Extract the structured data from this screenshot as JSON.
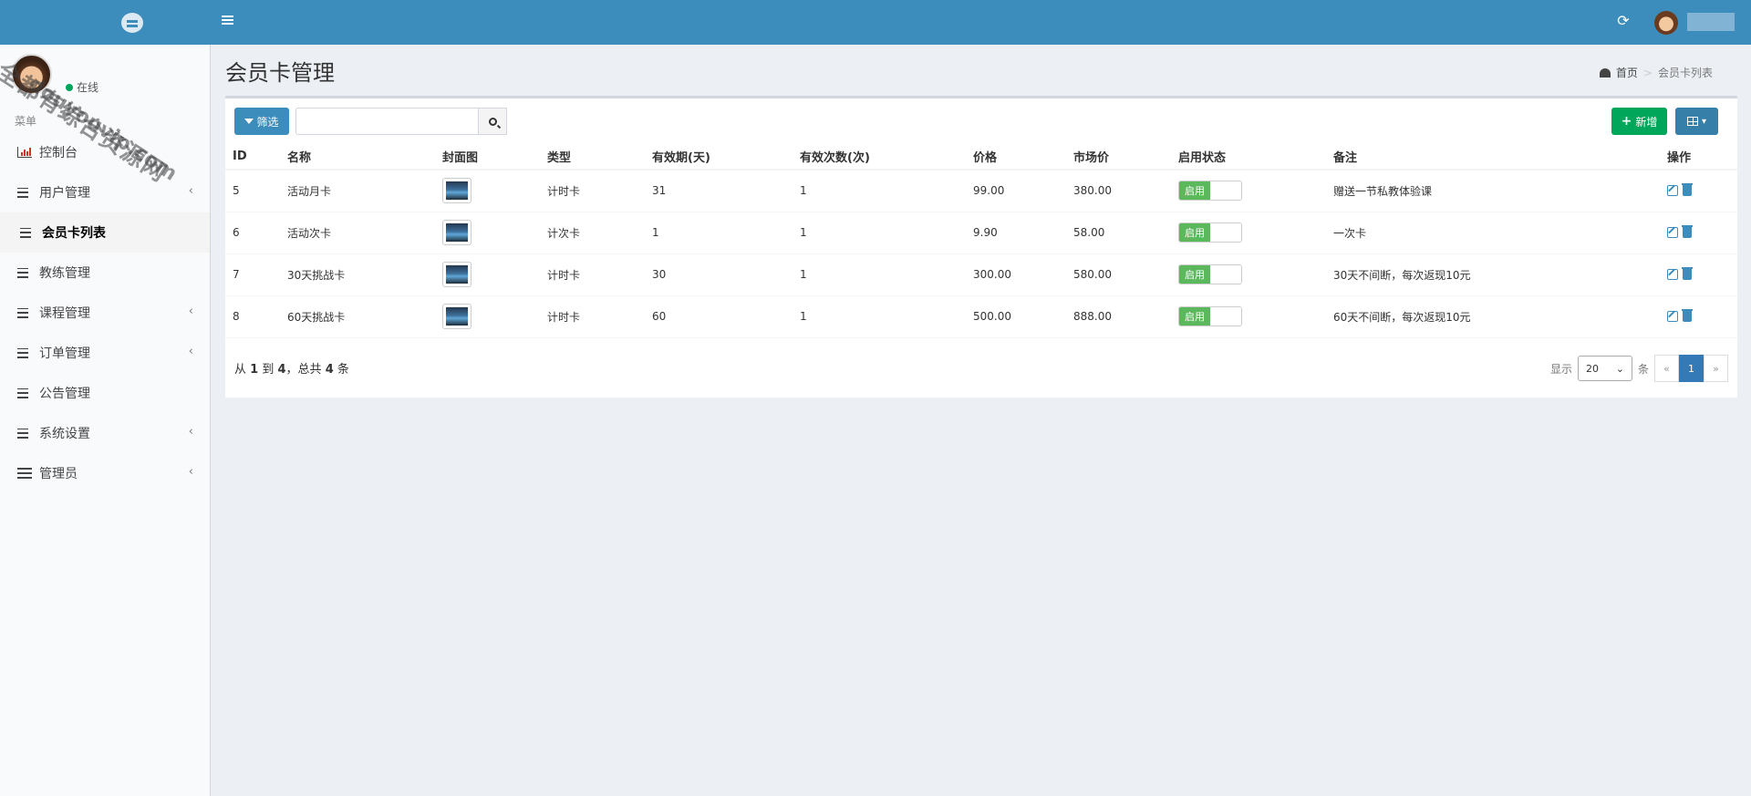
{
  "header": {
    "refresh_icon": "refresh-icon",
    "menu_toggle_icon": "hamburger-icon"
  },
  "sidebar": {
    "status": "在线",
    "menu_header": "菜单",
    "items": [
      {
        "label": "控制台",
        "icon": "bar-chart-icon",
        "has_children": false,
        "active": false
      },
      {
        "label": "用户管理",
        "icon": "list-icon",
        "has_children": true,
        "active": false
      },
      {
        "label": "会员卡列表",
        "icon": "list-icon",
        "has_children": false,
        "active": true
      },
      {
        "label": "教练管理",
        "icon": "list-icon",
        "has_children": false,
        "active": false
      },
      {
        "label": "课程管理",
        "icon": "list-icon",
        "has_children": true,
        "active": false
      },
      {
        "label": "订单管理",
        "icon": "list-icon",
        "has_children": true,
        "active": false
      },
      {
        "label": "公告管理",
        "icon": "list-icon",
        "has_children": false,
        "active": false
      },
      {
        "label": "系统设置",
        "icon": "list-icon",
        "has_children": true,
        "active": false
      },
      {
        "label": "管理员",
        "icon": "table-icon",
        "has_children": true,
        "active": false
      }
    ]
  },
  "watermark": {
    "line1": "全都有综合资源网",
    "line2": "douyouvip.com"
  },
  "page": {
    "title": "会员卡管理",
    "breadcrumb": {
      "home": "首页",
      "current": "会员卡列表"
    }
  },
  "toolbar": {
    "filter_label": "筛选",
    "search_value": "",
    "add_label": "新增"
  },
  "table": {
    "headers": [
      "ID",
      "名称",
      "封面图",
      "类型",
      "有效期(天)",
      "有效次数(次)",
      "价格",
      "市场价",
      "启用状态",
      "备注",
      "操作"
    ],
    "rows": [
      {
        "id": "5",
        "name": "活动月卡",
        "type": "计时卡",
        "days": "31",
        "times": "1",
        "price": "99.00",
        "market": "380.00",
        "status": "启用",
        "note": "赠送一节私教体验课"
      },
      {
        "id": "6",
        "name": "活动次卡",
        "type": "计次卡",
        "days": "1",
        "times": "1",
        "price": "9.90",
        "market": "58.00",
        "status": "启用",
        "note": "一次卡"
      },
      {
        "id": "7",
        "name": "30天挑战卡",
        "type": "计时卡",
        "days": "30",
        "times": "1",
        "price": "300.00",
        "market": "580.00",
        "status": "启用",
        "note": "30天不间断，每次返现10元"
      },
      {
        "id": "8",
        "name": "60天挑战卡",
        "type": "计时卡",
        "days": "60",
        "times": "1",
        "price": "500.00",
        "market": "888.00",
        "status": "启用",
        "note": "60天不间断，每次返现10元"
      }
    ]
  },
  "pagination": {
    "from_label": "从",
    "from": "1",
    "to_label": "到",
    "to": "4",
    "total_label": "，总共",
    "total": "4",
    "unit": "条",
    "show_label": "显示",
    "per_page": "20",
    "per_page_unit": "条",
    "prev": "«",
    "current": "1",
    "next": "»"
  }
}
